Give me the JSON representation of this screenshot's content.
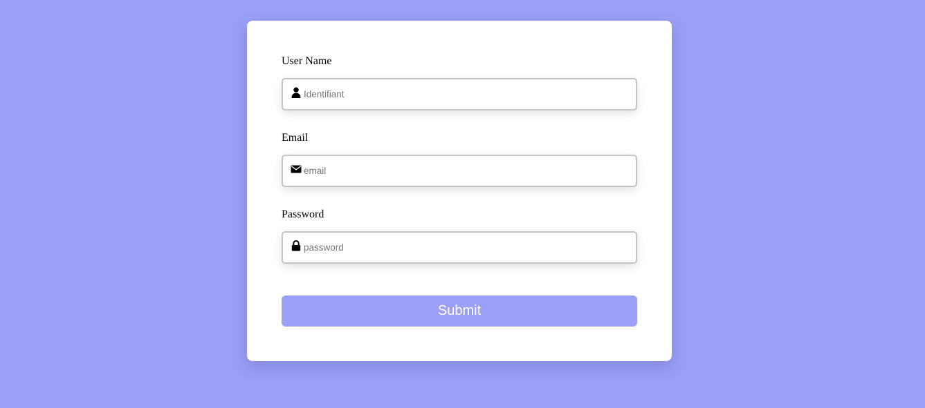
{
  "form": {
    "fields": [
      {
        "label": "User Name",
        "icon": "user-icon",
        "value": "",
        "placeholder": "Identifiant"
      },
      {
        "label": "Email",
        "icon": "envelope-icon",
        "value": "",
        "placeholder": "email"
      },
      {
        "label": "Password",
        "icon": "lock-icon",
        "value": "",
        "placeholder": "password"
      }
    ],
    "submit_label": "Submit"
  },
  "colors": {
    "background": "#9b9ff5",
    "card": "#ffffff",
    "accent": "#9b9ff5",
    "input_border": "#c4c4c4"
  }
}
